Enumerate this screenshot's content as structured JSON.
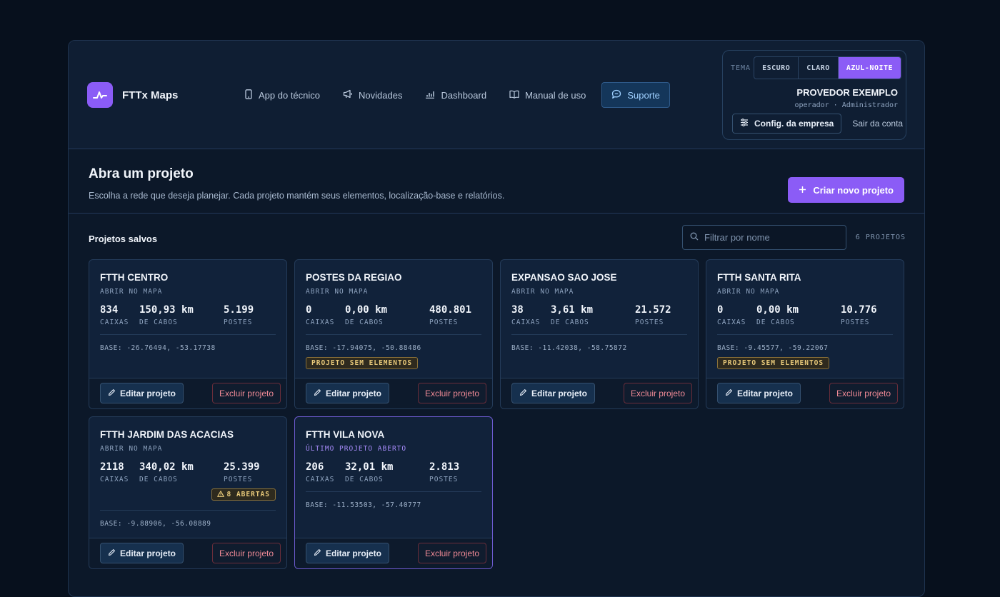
{
  "header": {
    "app_name": "FTTx Maps",
    "nav": [
      {
        "label": "App do técnico",
        "icon": "phone-icon"
      },
      {
        "label": "Novidades",
        "icon": "megaphone-icon"
      },
      {
        "label": "Dashboard",
        "icon": "bar-chart-icon"
      },
      {
        "label": "Manual de uso",
        "icon": "book-icon"
      },
      {
        "label": "Suporte",
        "icon": "chat-icon",
        "active": true
      }
    ]
  },
  "account": {
    "theme_label": "TEMA",
    "themes": [
      "ESCURO",
      "CLARO",
      "AZUL-NOITE"
    ],
    "theme_selected": "AZUL-NOITE",
    "org_name": "PROVEDOR EXEMPLO",
    "user": "operador",
    "role": "Administrador",
    "role_line": "operador · Administrador",
    "config_label": "Config. da empresa",
    "logout_label": "Sair da conta"
  },
  "hero": {
    "title": "Abra um projeto",
    "subtitle": "Escolha a rede que deseja planejar. Cada projeto mantém seus elementos, localização-base e relatórios.",
    "create_label": "Criar novo projeto"
  },
  "projects_section": {
    "title": "Projetos salvos",
    "search_placeholder": "Filtrar por nome",
    "count_label": "6 PROJETOS"
  },
  "labels": {
    "caixas": "CAIXAS",
    "cabos": "DE CABOS",
    "postes": "POSTES",
    "edit": "Editar projeto",
    "delete": "Excluir projeto"
  },
  "projects": [
    {
      "name": "FTTH CENTRO",
      "subtitle": "ABRIR NO MAPA",
      "recent": false,
      "caixas": "834",
      "cabos": "150,93 km",
      "postes": "5.199",
      "base": "BASE:  -26.76494, -53.17738",
      "badge": "",
      "warning": ""
    },
    {
      "name": "POSTES DA REGIAO",
      "subtitle": "ABRIR NO MAPA",
      "recent": false,
      "caixas": "0",
      "cabos": "0,00 km",
      "postes": "480.801",
      "base": "BASE:  -17.94075, -50.88486",
      "badge": "PROJETO SEM ELEMENTOS",
      "warning": ""
    },
    {
      "name": "EXPANSAO SAO JOSE",
      "subtitle": "ABRIR NO MAPA",
      "recent": false,
      "caixas": "38",
      "cabos": "3,61 km",
      "postes": "21.572",
      "base": "BASE:  -11.42038, -58.75872",
      "badge": "",
      "warning": ""
    },
    {
      "name": "FTTH SANTA RITA",
      "subtitle": "ABRIR NO MAPA",
      "recent": false,
      "caixas": "0",
      "cabos": "0,00 km",
      "postes": "10.776",
      "base": "BASE:  -9.45577, -59.22067",
      "badge": "PROJETO SEM ELEMENTOS",
      "warning": ""
    },
    {
      "name": "FTTH JARDIM DAS ACACIAS",
      "subtitle": "ABRIR NO MAPA",
      "recent": false,
      "caixas": "2118",
      "cabos": "340,02 km",
      "postes": "25.399",
      "base": "BASE:  -9.88906, -56.08889",
      "badge": "",
      "warning": "8 ABERTAS"
    },
    {
      "name": "FTTH VILA NOVA",
      "subtitle": "ÚLTIMO PROJETO ABERTO",
      "recent": true,
      "caixas": "206",
      "cabos": "32,01 km",
      "postes": "2.813",
      "base": "BASE:  -11.53503, -57.40777",
      "badge": "",
      "warning": ""
    }
  ],
  "colors": {
    "accent": "#8b5cf6",
    "background": "#07101d",
    "danger": "#f08a96",
    "warning": "#e8c97a"
  }
}
